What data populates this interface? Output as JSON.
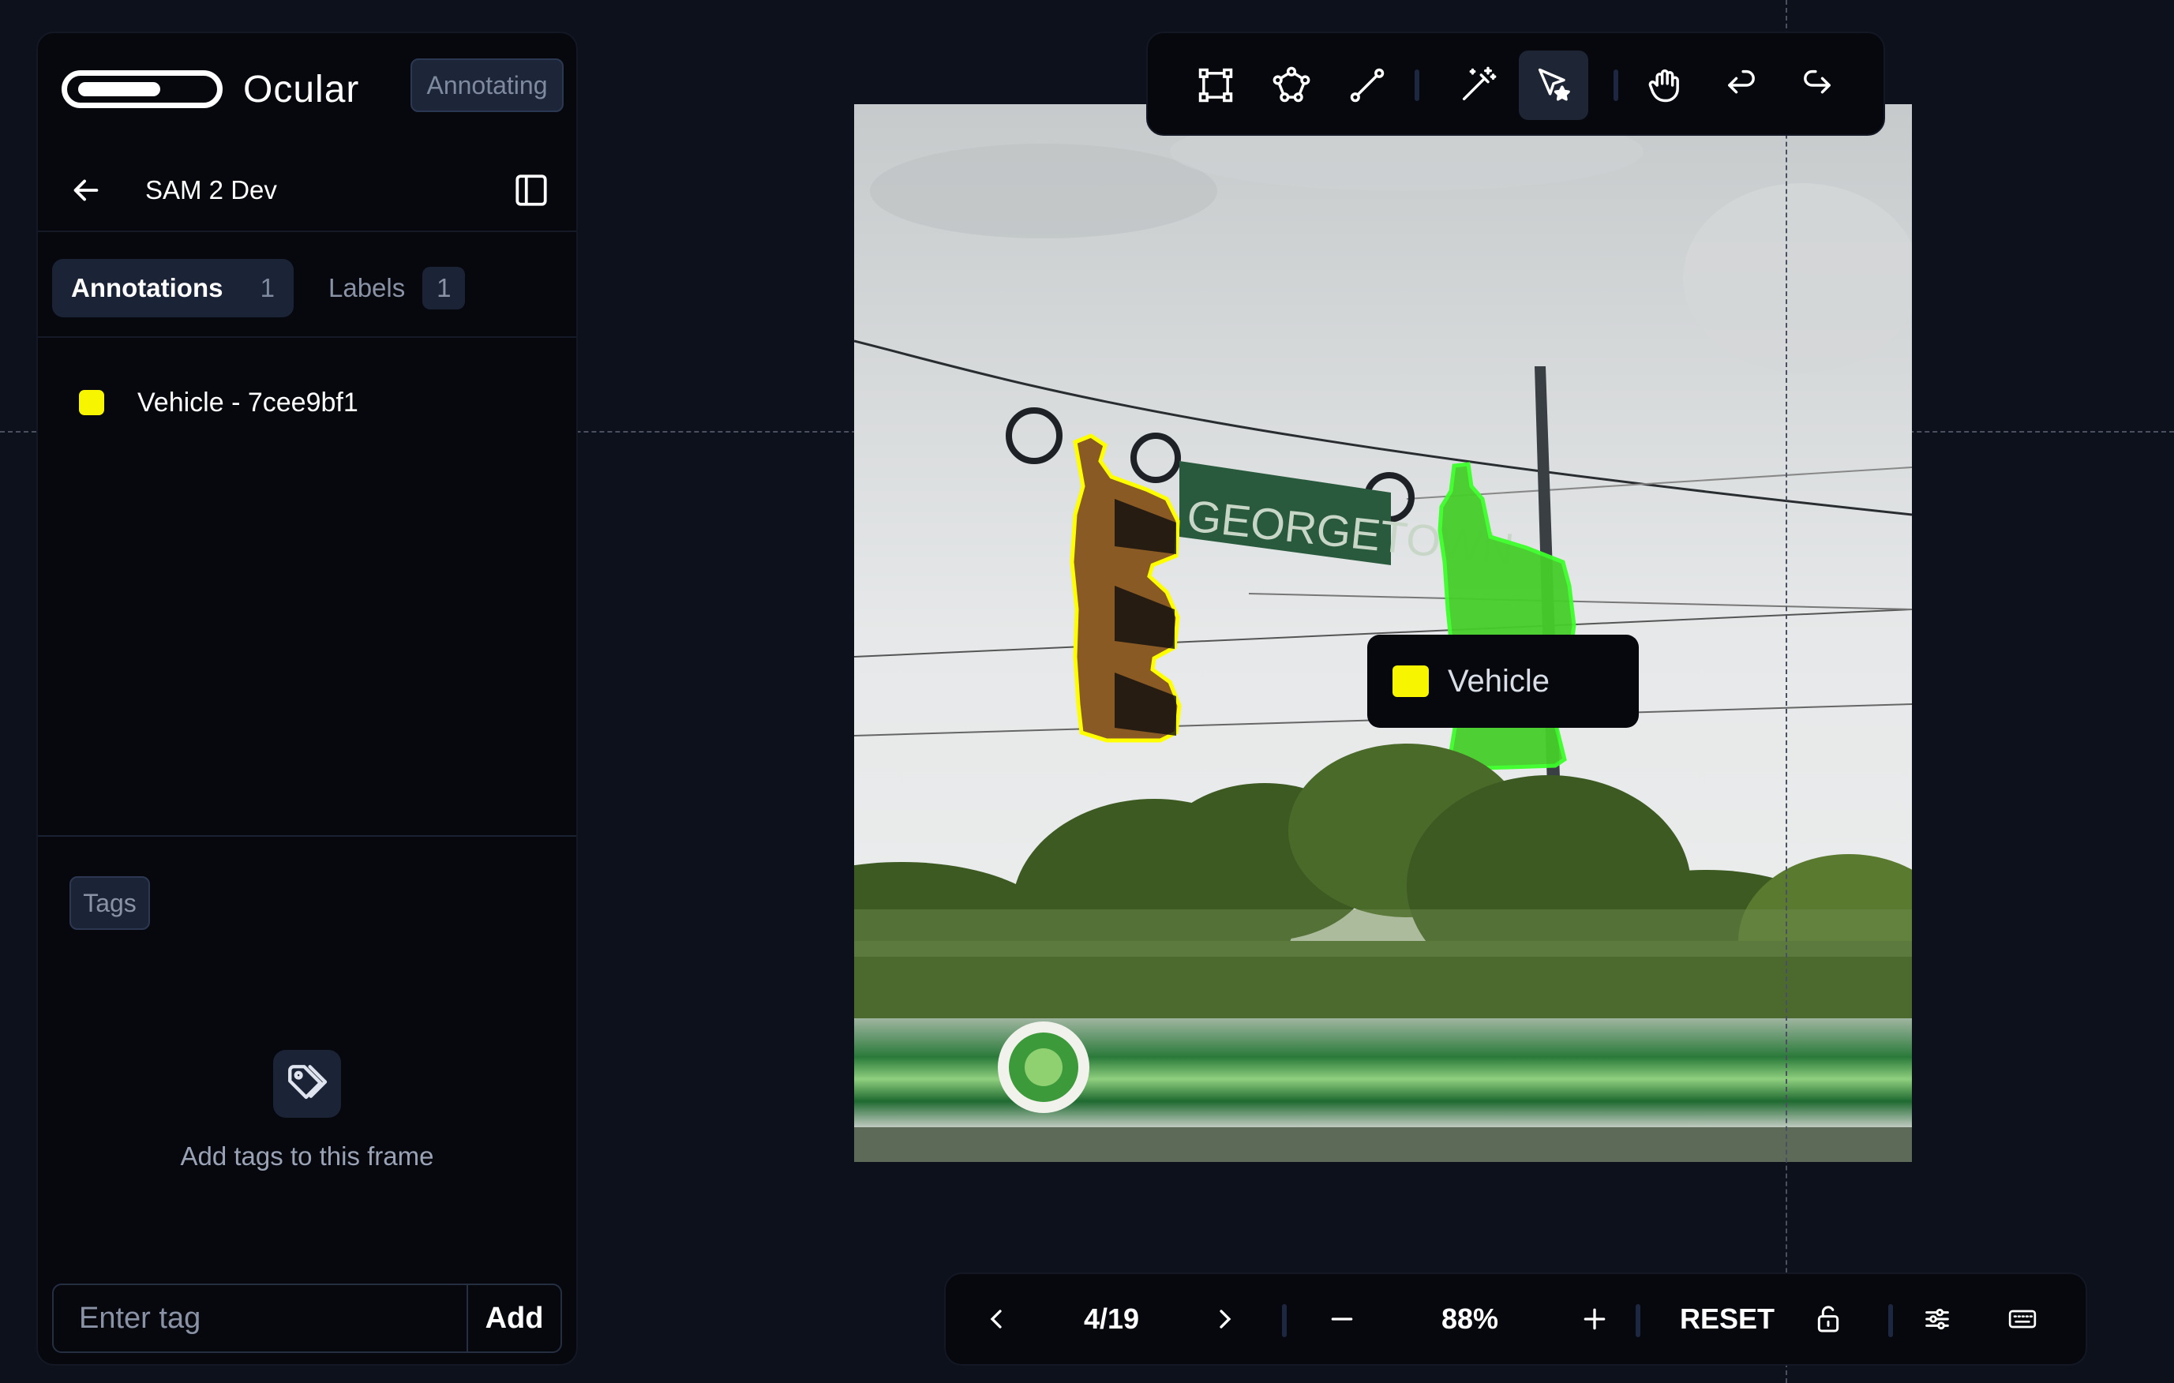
{
  "app": {
    "name": "Ocular",
    "status": "Annotating"
  },
  "project": {
    "title": "SAM 2 Dev"
  },
  "tabs": {
    "annotations": {
      "label": "Annotations",
      "count": "1"
    },
    "labels": {
      "label": "Labels",
      "count": "1"
    }
  },
  "annotations": [
    {
      "label": "Vehicle - 7cee9bf1",
      "color": "#f7f500"
    }
  ],
  "tags": {
    "header": "Tags",
    "empty_text": "Add tags to this frame",
    "input_placeholder": "Enter tag",
    "add_label": "Add"
  },
  "toolbar": {
    "tools": [
      "bounding-box-icon",
      "polygon-icon",
      "line-icon",
      "magic-wand-icon",
      "smart-select-icon",
      "hand-icon",
      "undo-icon",
      "redo-icon"
    ],
    "active_tool": "smart-select-icon"
  },
  "tooltip": {
    "label": "Vehicle",
    "color": "#f7f500"
  },
  "masks": [
    {
      "name": "yellow-mask",
      "color": "#ffff00"
    },
    {
      "name": "green-mask",
      "color": "#3cff2a"
    }
  ],
  "image": {
    "sign_text": "GEORGETOWN"
  },
  "navigation": {
    "frame": "4/19",
    "zoom": "88%",
    "reset_label": "RESET"
  }
}
